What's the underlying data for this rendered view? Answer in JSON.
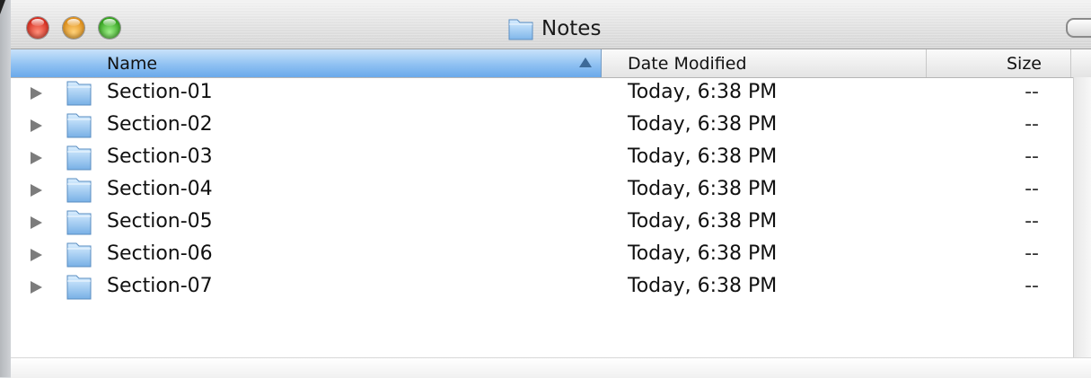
{
  "window": {
    "title": "Notes",
    "folder_icon": "folder-icon"
  },
  "columns": {
    "name": "Name",
    "date_modified": "Date Modified",
    "size": "Size",
    "sort": "ascending"
  },
  "rows": [
    {
      "name": "Section-01",
      "date": "Today, 6:38 PM",
      "size": "--"
    },
    {
      "name": "Section-02",
      "date": "Today, 6:38 PM",
      "size": "--"
    },
    {
      "name": "Section-03",
      "date": "Today, 6:38 PM",
      "size": "--"
    },
    {
      "name": "Section-04",
      "date": "Today, 6:38 PM",
      "size": "--"
    },
    {
      "name": "Section-05",
      "date": "Today, 6:38 PM",
      "size": "--"
    },
    {
      "name": "Section-06",
      "date": "Today, 6:38 PM",
      "size": "--"
    },
    {
      "name": "Section-07",
      "date": "Today, 6:38 PM",
      "size": "--"
    }
  ],
  "colors": {
    "header_selected": "#8fc1f2",
    "close": "#d62d1f",
    "minimize": "#e0901a",
    "zoom": "#35a51f"
  }
}
